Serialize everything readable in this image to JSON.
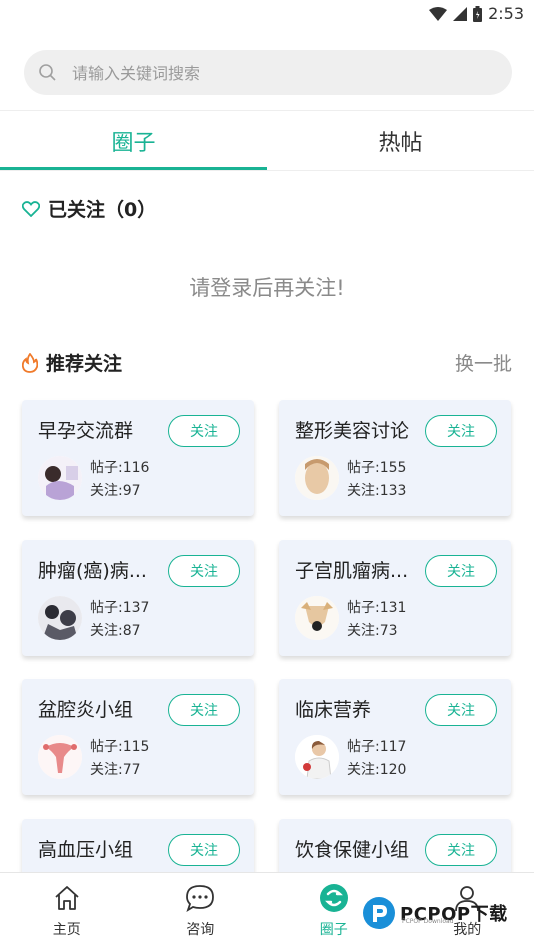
{
  "status_bar": {
    "time": "2:53"
  },
  "search": {
    "placeholder": "请输入关键词搜索"
  },
  "tabs": [
    {
      "label": "圈子"
    },
    {
      "label": "热帖"
    }
  ],
  "followed": {
    "title": "已关注（0）",
    "empty_tip": "请登录后再关注!"
  },
  "recommend": {
    "title": "推荐关注",
    "refresh_label": "换一批",
    "cards": [
      {
        "name": "早孕交流群",
        "button": "关注",
        "posts": "帖子:116",
        "followers": "关注:97"
      },
      {
        "name": "整形美容讨论",
        "button": "关注",
        "posts": "帖子:155",
        "followers": "关注:133"
      },
      {
        "name": "肿瘤(癌)病...",
        "button": "关注",
        "posts": "帖子:137",
        "followers": "关注:87"
      },
      {
        "name": "子宫肌瘤病...",
        "button": "关注",
        "posts": "帖子:131",
        "followers": "关注:73"
      },
      {
        "name": "盆腔炎小组",
        "button": "关注",
        "posts": "帖子:115",
        "followers": "关注:77"
      },
      {
        "name": "临床营养",
        "button": "关注",
        "posts": "帖子:117",
        "followers": "关注:120"
      },
      {
        "name": "高血压小组",
        "button": "关注"
      },
      {
        "name": "饮食保健小组",
        "button": "关注"
      }
    ]
  },
  "bottom_nav": [
    {
      "label": "主页",
      "icon": "home-icon"
    },
    {
      "label": "咨询",
      "icon": "chat-icon"
    },
    {
      "label": "圈子",
      "icon": "circle-icon"
    },
    {
      "label": "我的",
      "icon": "user-icon"
    }
  ],
  "watermark": {
    "text": "PCPOP下载",
    "subtext": "PCPOP Download"
  },
  "colors": {
    "accent": "#19b394",
    "card_bg": "#eff3fb",
    "fire": "#f07a2a"
  }
}
